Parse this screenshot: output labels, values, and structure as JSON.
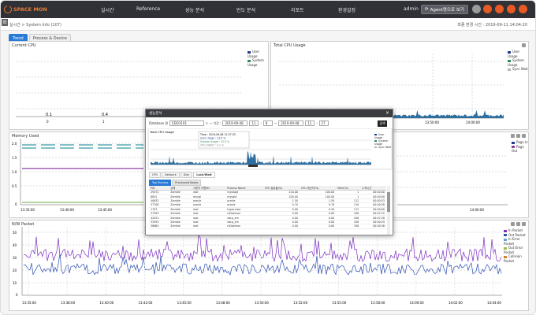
{
  "header": {
    "logo_text": "SPACE MON",
    "nav": [
      "실시간",
      "Reference",
      "성능 분석",
      "빈도 분석",
      "리포트",
      "환경설정"
    ],
    "user": "admin",
    "agent_button": "Agent명으로 보기"
  },
  "breadcrumb": "실시간 > System Info (107)",
  "timestamp": "최종 변경 시간 : 2019-09-11 14:04:20",
  "tabs": [
    "Trend",
    "Process & Device"
  ],
  "panels": {
    "current_cpu": {
      "title": "Current CPU",
      "legend": [
        "User Usage",
        "System Usage"
      ],
      "bar_labels": [
        "0.1",
        "0.4"
      ],
      "x_ticks": [
        "0",
        "1"
      ]
    },
    "total_cpu": {
      "title": "Total CPU Usage",
      "legend": [
        "User Usage",
        "System Usage",
        "Sync Wait"
      ],
      "x_ticks": [
        "13:50:00",
        "14:00:00"
      ]
    },
    "memory": {
      "title": "Memory Used",
      "y_ticks": [
        "2.0",
        "1.5",
        "1.0",
        "0.5",
        "0"
      ],
      "x_ticks": [
        "13:35:00",
        "13:40:00",
        "13:45:00"
      ]
    },
    "paging": {
      "legend": [
        "Page In",
        "Page Out"
      ],
      "x_ticks": [
        "14:00:00"
      ]
    },
    "nw": {
      "title": "N/W Packet",
      "legend": [
        "In Packet",
        "Out Packet",
        "In Error Packet",
        "Out Error Packet",
        "Collision Packet"
      ],
      "y_ticks": [
        "50",
        "40",
        "30",
        "20",
        "10",
        "0"
      ],
      "x_ticks": [
        "13:35:00",
        "13:38:00",
        "13:40:00",
        "13:42:00",
        "13:45:00",
        "13:48:00",
        "13:50:00",
        "13:52:00",
        "13:55:00",
        "13:58:00",
        "14:00:00",
        "14:02:00",
        "14:04:00"
      ]
    }
  },
  "modal": {
    "title": "성능분석",
    "filter": {
      "label": "Database 명",
      "db": "SDO3101",
      "range_label": "~ 기간 :",
      "from_date": "2019-09-08",
      "from_h": "11",
      "from_m": "8",
      "to_date": "2019-09-08",
      "to_h": "11",
      "to_m": "27",
      "query": "검색"
    },
    "chart": {
      "title": "Total CPU Usage",
      "legend": [
        "User Usage",
        "System Usage",
        "Sync Wait"
      ],
      "tooltip": [
        "Time : 2019-09-08 11:27:33",
        "User Usage : 23.0 %",
        "System Usage : 12.5 %",
        "CPU UWAIT : 0.1 %"
      ]
    },
    "tabs": [
      "CPU",
      "Network",
      "Disk",
      "Lock/Wait"
    ],
    "process_tabs": [
      "Top Process",
      "Processed Name"
    ],
    "columns": [
      "PID",
      "상태",
      "사용자 이름/ID",
      "Process Name",
      "CPU 점유율(%)",
      "CPU 계산치(%)",
      "Mem(%)",
      "누적시간"
    ],
    "rows": [
      [
        "29472",
        "Zombie",
        "root",
        "rsyslogd",
        "220.00",
        "100.00",
        "1",
        "00:00:00"
      ],
      [
        "6841",
        "Zombie",
        "mysql",
        "mysqld",
        "100.00",
        "100.00",
        "1",
        "00:00:00"
      ],
      [
        "40632",
        "Zombie",
        "oracle",
        "oracle",
        "1.50",
        "1.50",
        "112",
        "00:00:53"
      ],
      [
        "37708",
        "Zombie",
        "oracle",
        "oracle",
        "0.70",
        "0.70",
        "110",
        "00:00:28"
      ],
      [
        "1707",
        "Zombie",
        "root",
        "hypervisor",
        "0.00",
        "0.30",
        "112",
        "00:00:00"
      ],
      [
        "37493",
        "Zombie",
        "root",
        "rsDaemon",
        "0.00",
        "0.00",
        "108",
        "00:07:22"
      ],
      [
        "42031",
        "Zombie",
        "root",
        "sdcp_em",
        "0.00",
        "0.00",
        "108",
        "00:07:28"
      ],
      [
        "33591",
        "Zombie",
        "root",
        "sdcp_em",
        "0.00",
        "0.00",
        "108",
        "00:00:29"
      ],
      [
        "38684",
        "Zombie",
        "root",
        "rsDaemon",
        "0.00",
        "0.00",
        "108",
        "00:00:36"
      ]
    ]
  },
  "colors": {
    "accent": "#2a7bd5",
    "topbar": "#2f3136",
    "user_series": "#1f3a8a",
    "system_series": "#2e8b57",
    "sync_series": "#b2b2b2",
    "in_packet": "#7b2fbf",
    "out_packet": "#2d4fb0",
    "memory_teal": "#3a9aa6",
    "memory_purple": "#8a3fa0",
    "memory_green": "#6aa640"
  }
}
